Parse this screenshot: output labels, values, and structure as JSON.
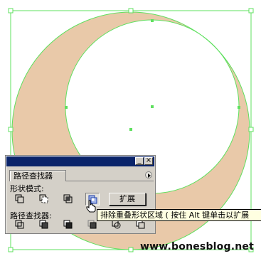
{
  "canvas": {
    "fill_color": "#e9c9a9",
    "selection_color": "#5fe05f"
  },
  "palette": {
    "tab_label": "路径查找器",
    "shape_modes_label": "形状模式:",
    "pathfinders_label": "路径查找器:",
    "expand_button": "扩展",
    "titlebar_minimize": "_",
    "titlebar_close": "×",
    "shape_mode_buttons": [
      "add-to-shape-area",
      "subtract-from-shape-area",
      "intersect-shape-areas",
      "exclude-overlapping-shape-areas"
    ],
    "pathfinder_buttons": [
      "divide",
      "trim",
      "merge",
      "crop",
      "outline",
      "minus-back"
    ],
    "selected_button": "exclude-overlapping-shape-areas"
  },
  "tooltip": {
    "text": "排除重叠形状区域 ( 按住 Alt 键单击以扩展"
  },
  "watermark": {
    "text": "www.bonesblog.net"
  }
}
